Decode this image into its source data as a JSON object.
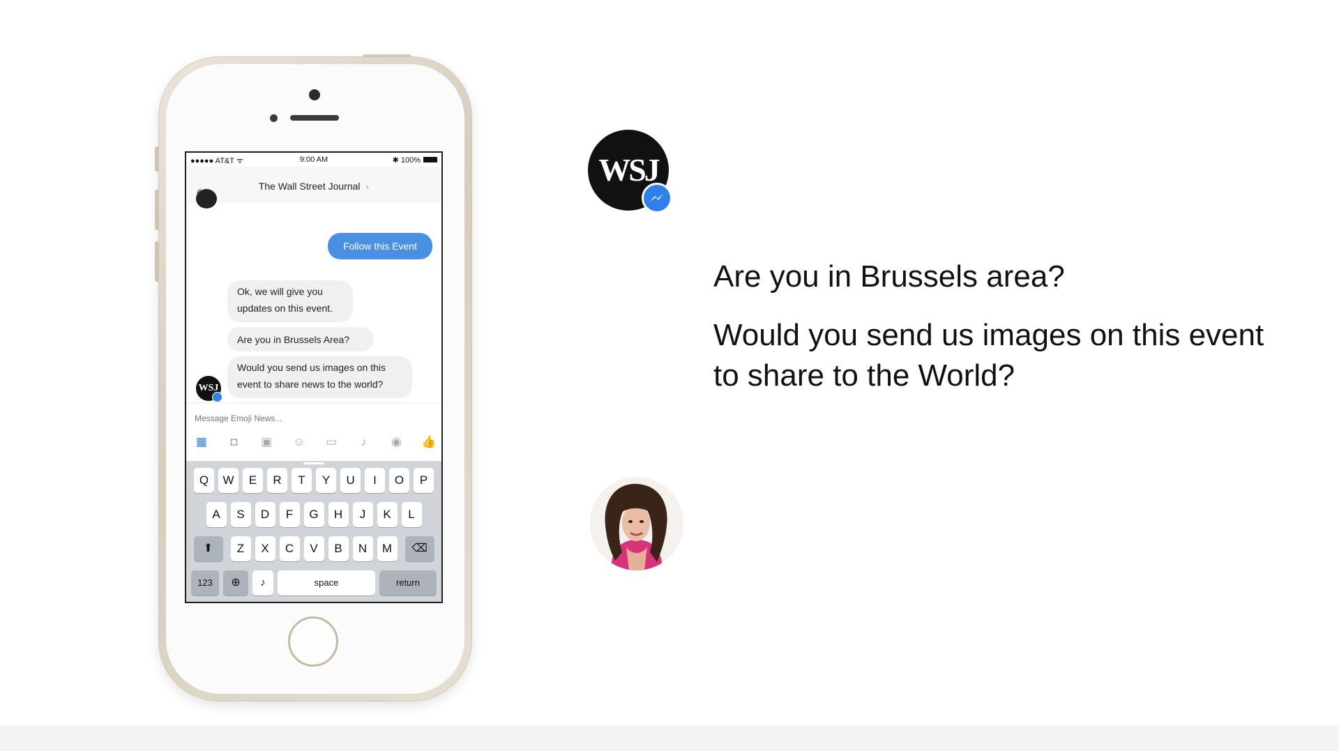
{
  "status_bar": {
    "carrier": "●●●●● AT&T ᯤ",
    "time": "9:00 AM",
    "battery": "✱ 100%"
  },
  "nav": {
    "back_glyph": "‹",
    "title": "The Wall Street Journal",
    "arrow": "›"
  },
  "messages": {
    "outgoing": "Follow this Event",
    "reply_1": "Ok, we will give you updates on this event.",
    "reply_2": "Are you in Brussels Area?",
    "reply_3": "Would you send us images on this event to share news to the world?"
  },
  "chat_avatar_text": "WSJ",
  "composer": {
    "placeholder": "Message Emoji News..."
  },
  "keyboard": {
    "row1": [
      "Q",
      "W",
      "E",
      "R",
      "T",
      "Y",
      "U",
      "I",
      "O",
      "P"
    ],
    "row2": [
      "A",
      "S",
      "D",
      "F",
      "G",
      "H",
      "J",
      "K",
      "L"
    ],
    "row3": [
      "Z",
      "X",
      "C",
      "V",
      "B",
      "N",
      "M"
    ],
    "numbers": "123",
    "space": "space",
    "return": "return"
  },
  "brand": {
    "logo_text": "WSJ"
  },
  "questions": {
    "q1": "Are you in Brussels area?",
    "q2": "Would you send us images on this event to share to the World?"
  },
  "colors": {
    "messenger_blue": "#2f80ed",
    "bubble_blue": "#4a90e2",
    "bubble_gray": "#f0f0f0"
  }
}
